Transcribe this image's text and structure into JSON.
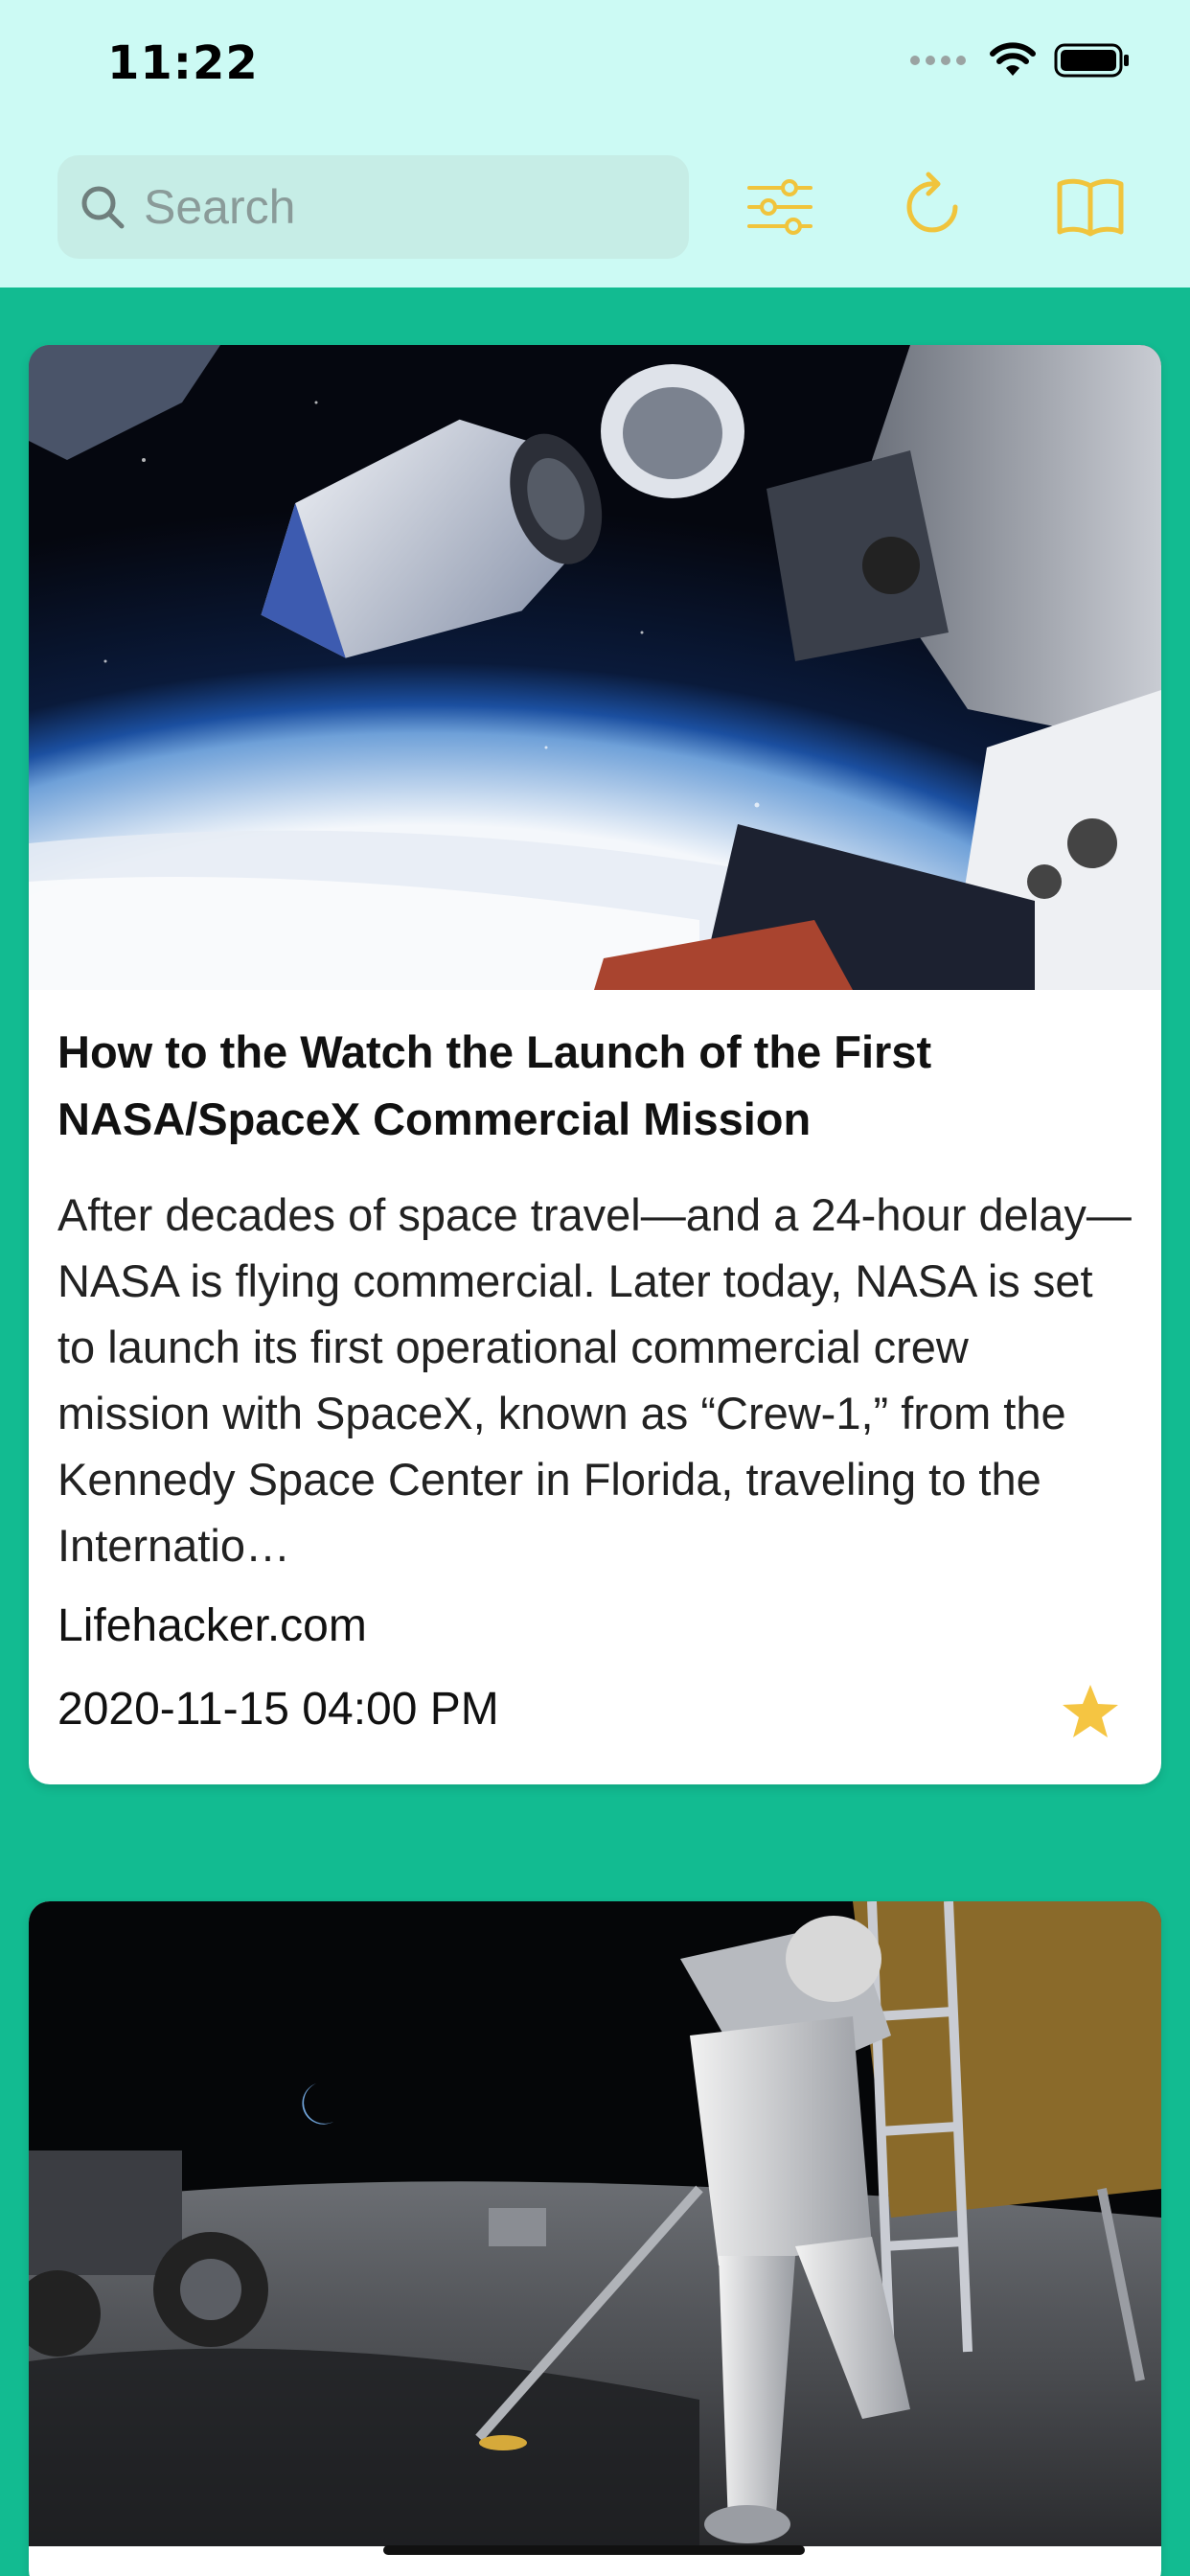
{
  "status_bar": {
    "time": "11:22",
    "signal_icon": "cellular-dots-icon",
    "wifi_icon": "wifi-icon",
    "battery_icon": "battery-icon"
  },
  "nav": {
    "search_placeholder": "Search",
    "search_icon": "search-icon",
    "filter_icon": "sliders-icon",
    "refresh_icon": "refresh-icon",
    "bookmarks_icon": "book-icon",
    "accent_color": "#f0c43c"
  },
  "colors": {
    "header_bg": "#ccfaf4",
    "feed_bg": "#12bb91",
    "card_bg": "#ffffff",
    "star": "#f5c542"
  },
  "articles": [
    {
      "title": "How to the Watch the Launch of the First NASA/SpaceX Commercial Mission",
      "summary": "After decades of space travel—and a 24-hour delay—NASA is flying commercial. Later today, NASA is set to launch its first operational commercial crew mission with SpaceX, known as “Crew-1,” from the Kennedy Space Center in Florida, traveling to the Internatio…",
      "source": "Lifehacker.com",
      "date": "2020-11-15 04:00 PM",
      "favorited": true,
      "image": "spacecraft-docking-image"
    },
    {
      "image": "astronaut-moon-image"
    }
  ]
}
